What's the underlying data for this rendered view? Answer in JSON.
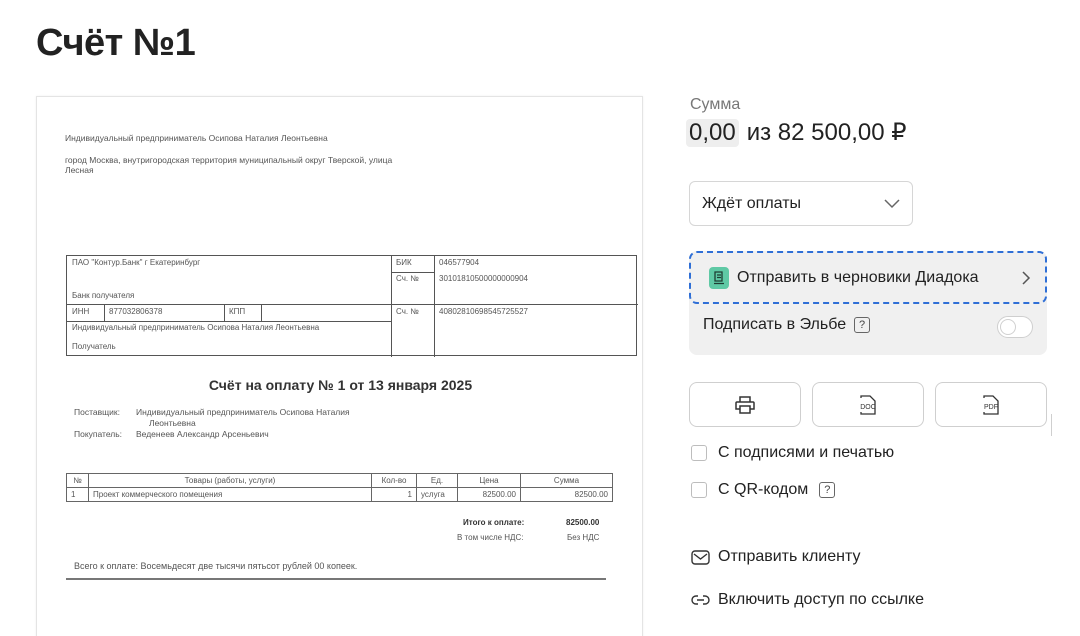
{
  "page": {
    "title": "Счёт №1"
  },
  "document": {
    "seller_line": "Индивидуальный предприниматель Осипова Наталия Леонтьевна",
    "address_line1": "город Москва, внутригородская территория муниципальный округ Тверской, улица",
    "address_line2": "Лесная",
    "bank": {
      "bank_name": "ПАО \"Контур.Банк\" г Екатеринбург",
      "bank_caption": "Банк получателя",
      "bik_label": "БИК",
      "bik_value": "046577904",
      "corr_label": "Сч. №",
      "corr_value": "30101810500000000904",
      "inn_label": "ИНН",
      "inn_value": "877032806378",
      "kpp_label": "КПП",
      "account_label": "Сч. №",
      "account_value": "40802810698545725527",
      "recipient_name": "Индивидуальный предприниматель Осипова Наталия Леонтьевна",
      "recipient_caption": "Получатель"
    },
    "heading": "Счёт на оплату № 1 от 13 января 2025",
    "supplier_label": "Поставщик:",
    "supplier_value_line1": "Индивидуальный предприниматель Осипова Наталия",
    "supplier_value_line2": "Леонтьевна",
    "buyer_label": "Покупатель:",
    "buyer_value": "Веденеев Александр Арсеньевич",
    "goods_headers": [
      "№",
      "Товары (работы, услуги)",
      "Кол-во",
      "Ед.",
      "Цена",
      "Сумма"
    ],
    "goods_rows": [
      [
        "1",
        "Проект коммерческого помещения",
        "1",
        "услуга",
        "82500.00",
        "82500.00"
      ]
    ],
    "total_label": "Итого к оплате:",
    "total_value": "82500.00",
    "vat_label": "В том числе НДС:",
    "vat_value": "Без НДС",
    "total_words": "Всего к оплате: Восемьдесят две тысячи пятьсот рублей 00 копеек."
  },
  "summary": {
    "label": "Сумма",
    "paid": "0,00",
    "total": "из 82 500,00 ₽"
  },
  "status_select": {
    "value": "Ждёт оплаты"
  },
  "diadoc": {
    "label": "Отправить в черновики Диадока"
  },
  "elba": {
    "label": "Подписать в Эльбе",
    "help": "?",
    "enabled": false
  },
  "file_buttons": [
    {
      "name": "print",
      "icon": "printer-icon"
    },
    {
      "name": "doc",
      "icon": "doc-file-icon",
      "badge": "DOC"
    },
    {
      "name": "pdf",
      "icon": "pdf-file-icon",
      "badge": "PDF"
    }
  ],
  "options": {
    "signatures_label": "С подписями и печатью",
    "qr_label": "С QR-кодом",
    "qr_help": "?"
  },
  "actions": {
    "send_client": "Отправить клиенту",
    "share_link": "Включить доступ по ссылке"
  },
  "colors": {
    "accent_dashed": "#2f6fd6",
    "diadoc_icon": "#5fc9a5"
  }
}
